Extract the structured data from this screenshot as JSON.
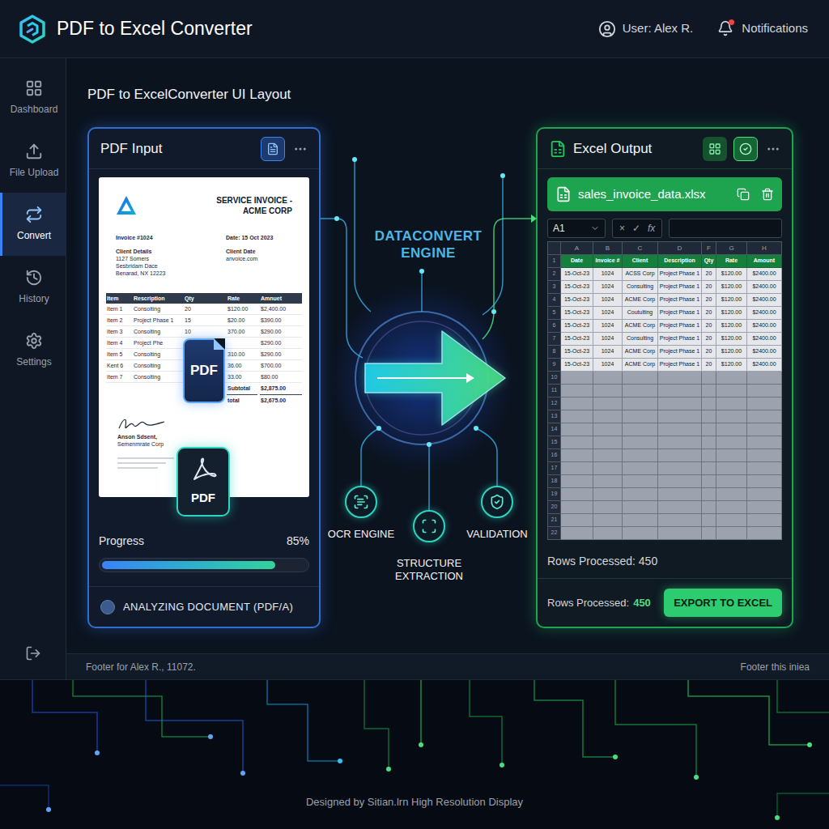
{
  "app": {
    "title": "PDF to Excel Converter"
  },
  "header": {
    "user": "User: Alex R.",
    "notifications": {
      "label": "Notifications",
      "unread": true
    }
  },
  "sidebar": {
    "items": [
      {
        "label": "Dashboard",
        "selected": false
      },
      {
        "label": "File Upload",
        "selected": false
      },
      {
        "label": "Convert",
        "selected": true
      },
      {
        "label": "History",
        "selected": false
      },
      {
        "label": "Settings",
        "selected": false
      }
    ]
  },
  "page": {
    "title": "PDF to ExcelConverter UI Layout"
  },
  "pdf_panel": {
    "title": "PDF Input",
    "document": {
      "title": "SERVICE INVOICE - ACME CORP",
      "invoice_no": "Invoice #1024",
      "date": "Date: 15 Oct 2023",
      "client_heading": "Client Details",
      "client_lines": [
        "1127 Somers",
        "Sesbridam Dace",
        "Benarad, NX 12223"
      ],
      "right_heading": "Client Date",
      "right_lines": [
        "anvoice.com"
      ],
      "table": {
        "columns": [
          "Item",
          "Rescription",
          "Qty",
          "Rate",
          "Amnuet"
        ],
        "rows": [
          [
            "Item 1",
            "Consolting",
            "20",
            "$120.00",
            "$2,400.00"
          ],
          [
            "Item 2",
            "Project Phase 1",
            "15",
            "$20.00",
            "$390.00"
          ],
          [
            "Item 3",
            "Consolting",
            "10",
            "370.00",
            "$290.00"
          ],
          [
            "Item 4",
            "Project Phe",
            "",
            "",
            "$290.00"
          ],
          [
            "Item 5",
            "Consolting",
            "",
            "310.00",
            "$290.00"
          ],
          [
            "Kent 6",
            "Consolting",
            "",
            "36.00",
            "$700.00"
          ],
          [
            "Item 7",
            "Consolting",
            "",
            "33.00",
            "$80.00"
          ]
        ]
      },
      "subtotal": {
        "label": "Subtotal",
        "value": "$2,875.00"
      },
      "total": {
        "label": "total",
        "value": "$2,675.00"
      },
      "signer": [
        "Anson Sdsent,",
        "Semenmrate Corp"
      ]
    },
    "badges": [
      "PDF",
      "PDF"
    ],
    "progress": {
      "label": "Progress",
      "reading": "85%",
      "level": 0.85
    },
    "status": "ANALYZING DOCUMENT (PDF/A)"
  },
  "engine": {
    "title": "DATACONVERT ENGINE",
    "stages": [
      "OCR ENGINE",
      "STRUCTURE EXTRACTION",
      "VALIDATION"
    ]
  },
  "excel_panel": {
    "title": "Excel Output",
    "file": "sales_invoice_data.xlsx",
    "cell_ref": "A1",
    "formula_buttons": [
      "×",
      "✓",
      "fx"
    ],
    "formula": "",
    "sheet": {
      "columns": [
        "A",
        "B",
        "C",
        "D",
        "F",
        "G",
        "H"
      ],
      "rows": [
        {
          "num": "1",
          "header": true,
          "cells": [
            "Date",
            "Invoice #",
            "Client",
            "Description",
            "Qty",
            "Rate",
            "Amount"
          ]
        },
        {
          "num": "2",
          "header": false,
          "cells": [
            "15-Oct-23",
            "1024",
            "ACSS Corp",
            "Project Phase 1",
            "20",
            "$120.00",
            "$2400.00"
          ]
        },
        {
          "num": "3",
          "header": false,
          "cells": [
            "15-Oct-23",
            "1024",
            "Consulting",
            "Project Phase 1",
            "20",
            "$120.00",
            "$2400.00"
          ]
        },
        {
          "num": "4",
          "header": false,
          "cells": [
            "15-Oct-23",
            "1024",
            "ACME Corp",
            "Project Phase 1",
            "20",
            "$120.00",
            "$2400.00"
          ]
        },
        {
          "num": "5",
          "header": false,
          "cells": [
            "15-Oct-23",
            "1024",
            "Coutulting",
            "Project Phase 1",
            "20",
            "$120.00",
            "$2400.00"
          ]
        },
        {
          "num": "6",
          "header": false,
          "cells": [
            "15-Oct-23",
            "1024",
            "ACME Corp",
            "Project Phase 1",
            "20",
            "$120.00",
            "$2400.00"
          ]
        },
        {
          "num": "7",
          "header": false,
          "cells": [
            "15-Oct-23",
            "1024",
            "Consulting",
            "Project Phase 1",
            "20",
            "$120.00",
            "$2400.00"
          ]
        },
        {
          "num": "8",
          "header": false,
          "cells": [
            "15-Oct-23",
            "1024",
            "ACME Corp",
            "Project Phase 1",
            "20",
            "$120.00",
            "$2400.00"
          ]
        },
        {
          "num": "9",
          "header": false,
          "cells": [
            "15-Oct-23",
            "1024",
            "ACME Corp",
            "Project Phase 1",
            "20",
            "$120.00",
            "$2400.00"
          ]
        },
        {
          "num": "10",
          "header": false,
          "cells": []
        },
        {
          "num": "11",
          "header": false,
          "cells": []
        },
        {
          "num": "12",
          "header": false,
          "cells": []
        },
        {
          "num": "13",
          "header": false,
          "cells": []
        },
        {
          "num": "14",
          "header": false,
          "cells": []
        },
        {
          "num": "15",
          "header": false,
          "cells": []
        },
        {
          "num": "16",
          "header": false,
          "cells": []
        },
        {
          "num": "17",
          "header": false,
          "cells": []
        },
        {
          "num": "18",
          "header": false,
          "cells": []
        },
        {
          "num": "19",
          "header": false,
          "cells": []
        },
        {
          "num": "20",
          "header": false,
          "cells": []
        },
        {
          "num": "21",
          "header": false,
          "cells": []
        },
        {
          "num": "22",
          "header": false,
          "cells": []
        }
      ]
    },
    "rows_processed": "Rows Processed: 450",
    "footer": {
      "label": "Rows Processed:",
      "count": "450"
    },
    "export_button": "EXPORT TO EXCEL"
  },
  "footer": {
    "left": "Footer for Alex R., 11072.",
    "right": "Footer this iniea"
  },
  "credit": "Designed by Sitian.lrn High Resolution Display"
}
